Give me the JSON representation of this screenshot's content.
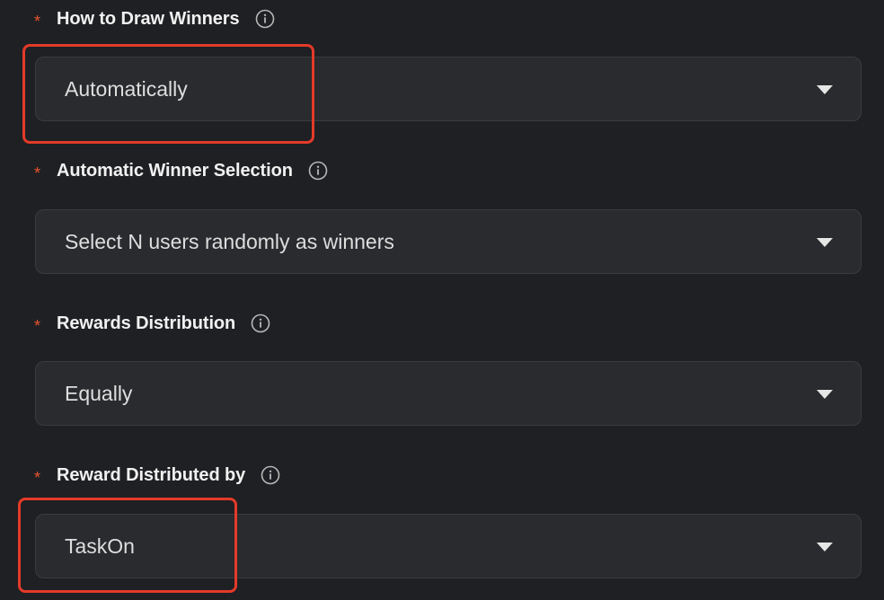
{
  "fields": [
    {
      "label": "How to Draw Winners",
      "required_mark": "*",
      "value": "Automatically"
    },
    {
      "label": "Automatic Winner Selection",
      "required_mark": "*",
      "value": "Select N users randomly as winners"
    },
    {
      "label": "Rewards Distribution",
      "required_mark": "*",
      "value": "Equally"
    },
    {
      "label": "Reward Distributed by",
      "required_mark": "*",
      "value": "TaskOn"
    }
  ],
  "icons": {
    "info": "info-circle-icon",
    "dropdown": "chevron-down-icon"
  },
  "colors": {
    "background": "#1f2023",
    "field_background": "#292b2e",
    "field_border": "#3a3c41",
    "required_mark": "#e9542e",
    "annotation_highlight": "#e43a29"
  }
}
